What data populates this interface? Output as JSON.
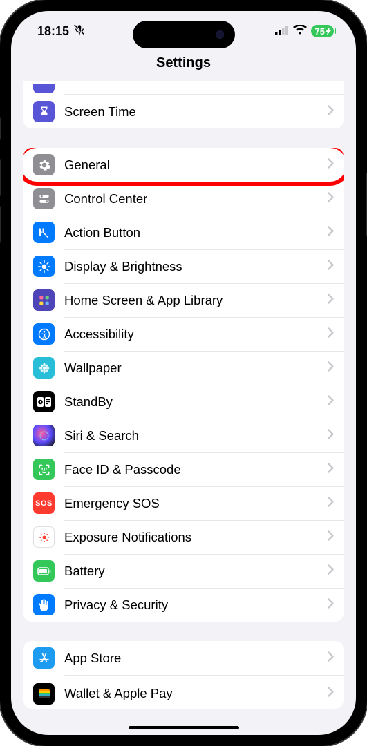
{
  "status": {
    "time": "18:15",
    "battery": "75"
  },
  "header": {
    "title": "Settings"
  },
  "groups": [
    {
      "id": "g1",
      "items": [
        {
          "id": "screen-time",
          "label": "Screen Time",
          "icon": "hourglass",
          "color": "#5856d6"
        }
      ]
    },
    {
      "id": "g2",
      "items": [
        {
          "id": "general",
          "label": "General",
          "icon": "gear",
          "color": "#8e8e93",
          "highlighted": true
        },
        {
          "id": "control-center",
          "label": "Control Center",
          "icon": "switches",
          "color": "#8e8e93"
        },
        {
          "id": "action-button",
          "label": "Action Button",
          "icon": "action",
          "color": "#007aff"
        },
        {
          "id": "display",
          "label": "Display & Brightness",
          "icon": "sun",
          "color": "#007aff"
        },
        {
          "id": "home-screen",
          "label": "Home Screen & App Library",
          "icon": "grid",
          "color": "#4d45b8"
        },
        {
          "id": "accessibility",
          "label": "Accessibility",
          "icon": "person",
          "color": "#007aff"
        },
        {
          "id": "wallpaper",
          "label": "Wallpaper",
          "icon": "flower",
          "color": "#28bed8"
        },
        {
          "id": "standby",
          "label": "StandBy",
          "icon": "standby",
          "color": "#000000"
        },
        {
          "id": "siri",
          "label": "Siri & Search",
          "icon": "siri",
          "color": "#222"
        },
        {
          "id": "faceid",
          "label": "Face ID & Passcode",
          "icon": "faceid",
          "color": "#34c759"
        },
        {
          "id": "sos",
          "label": "Emergency SOS",
          "icon": "sos",
          "color": "#ff3b30"
        },
        {
          "id": "exposure",
          "label": "Exposure Notifications",
          "icon": "exposure",
          "color": "#ffffff"
        },
        {
          "id": "battery",
          "label": "Battery",
          "icon": "battery",
          "color": "#34c759"
        },
        {
          "id": "privacy",
          "label": "Privacy & Security",
          "icon": "hand",
          "color": "#007aff"
        }
      ]
    },
    {
      "id": "g3",
      "items": [
        {
          "id": "appstore",
          "label": "App Store",
          "icon": "appstore",
          "color": "#1d9bf0"
        },
        {
          "id": "wallet",
          "label": "Wallet & Apple Pay",
          "icon": "wallet",
          "color": "#000000"
        }
      ]
    }
  ]
}
